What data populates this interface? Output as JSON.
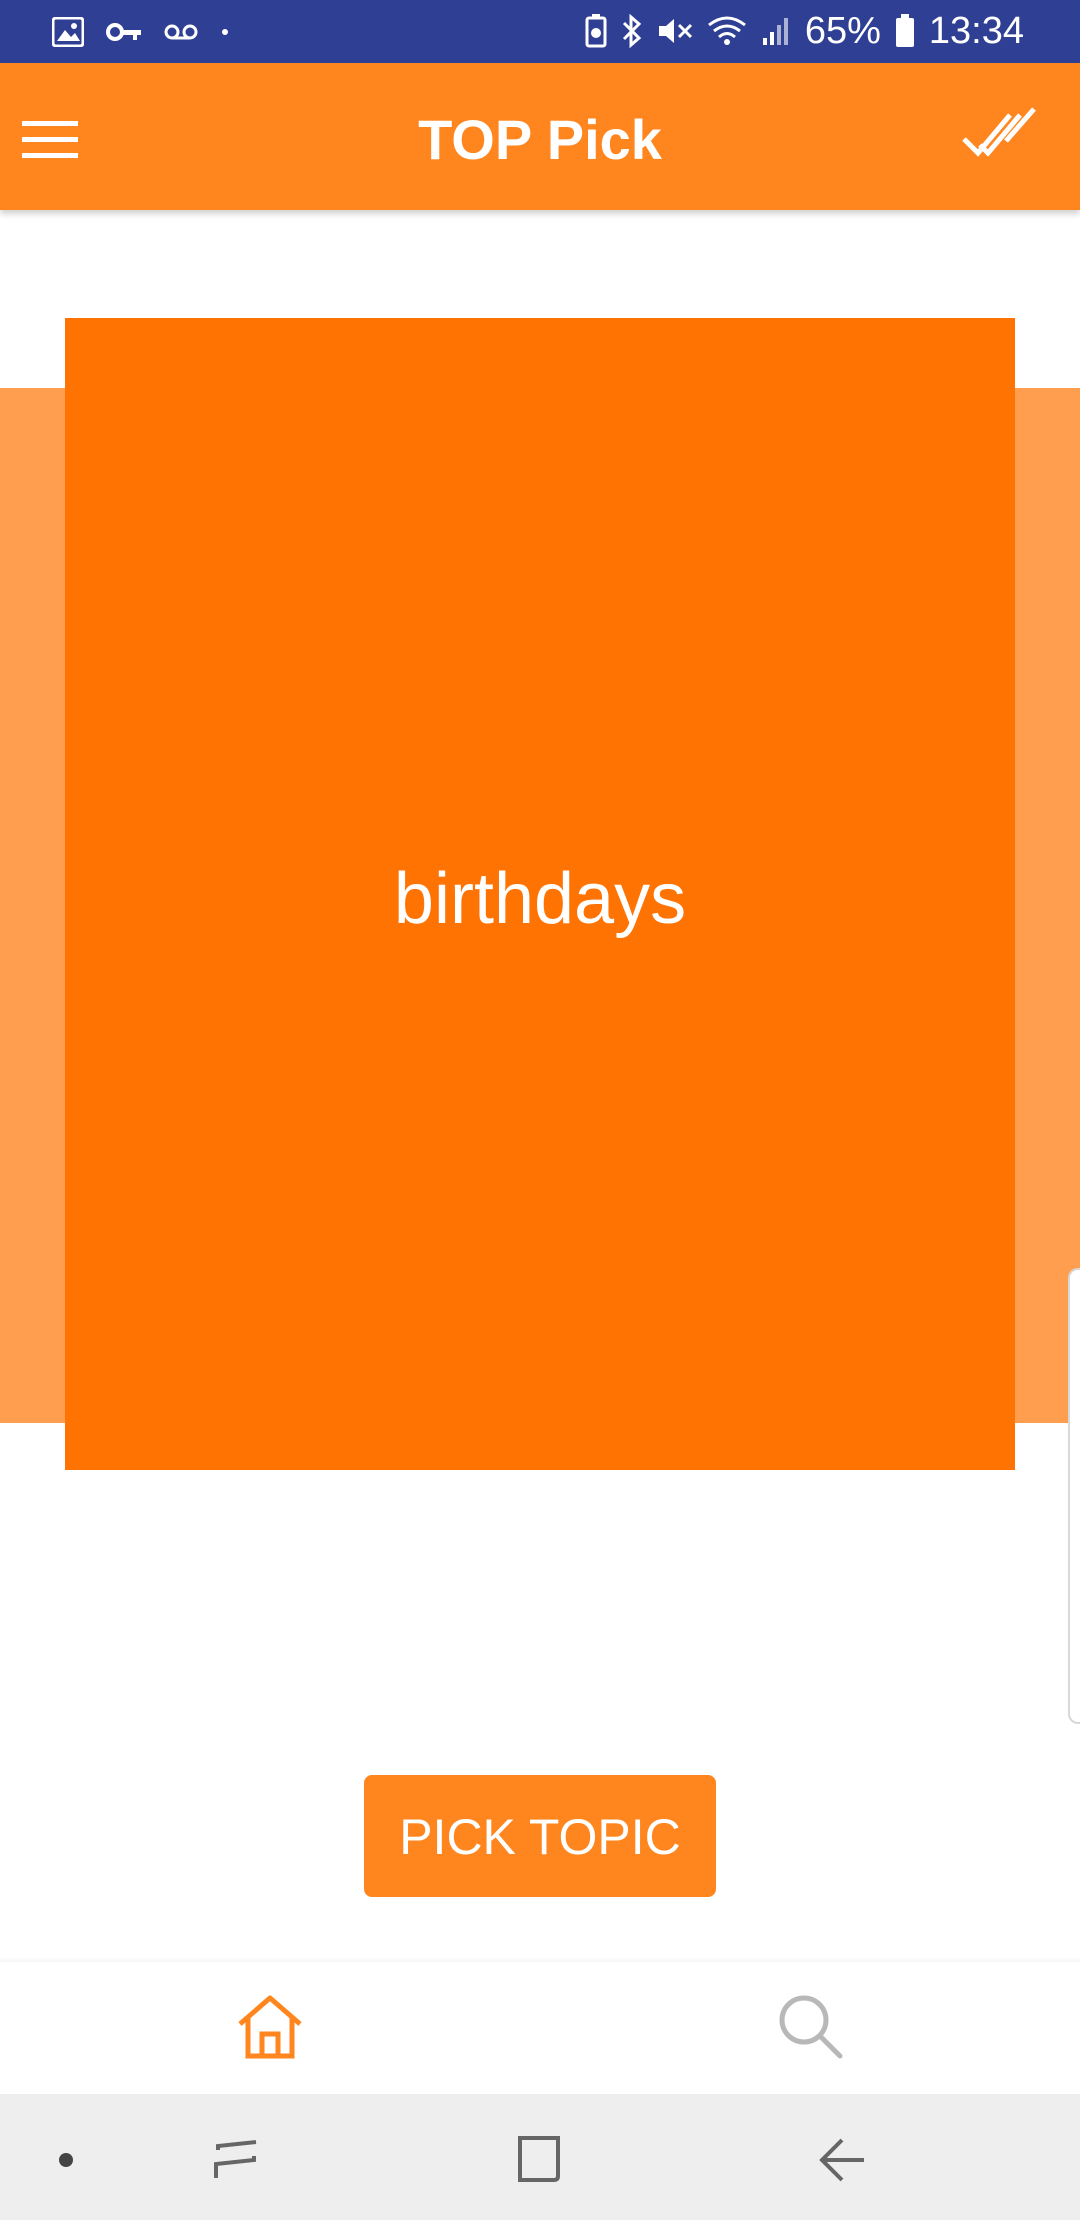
{
  "status_bar": {
    "battery_percent": "65%",
    "time": "13:34",
    "icons": [
      "image-icon",
      "key-icon",
      "voicemail-icon",
      "dot-icon",
      "battery-saver-icon",
      "bluetooth-icon",
      "mute-icon",
      "wifi-icon",
      "signal-icon",
      "battery-icon"
    ]
  },
  "app_bar": {
    "title": "TOP Pick",
    "menu_icon": "hamburger-menu-icon",
    "action_icon": "double-check-icon"
  },
  "card": {
    "text": "birthdays"
  },
  "actions": {
    "pick_label": "PICK TOPIC"
  },
  "bottom_nav": {
    "items": [
      "home-icon",
      "search-icon"
    ],
    "active": "home-icon"
  },
  "colors": {
    "status_bar": "#2f3f93",
    "app_bar": "#ff861f",
    "card": "#ff7303",
    "band": "#ff9e4f",
    "accent": "#ff861f"
  }
}
